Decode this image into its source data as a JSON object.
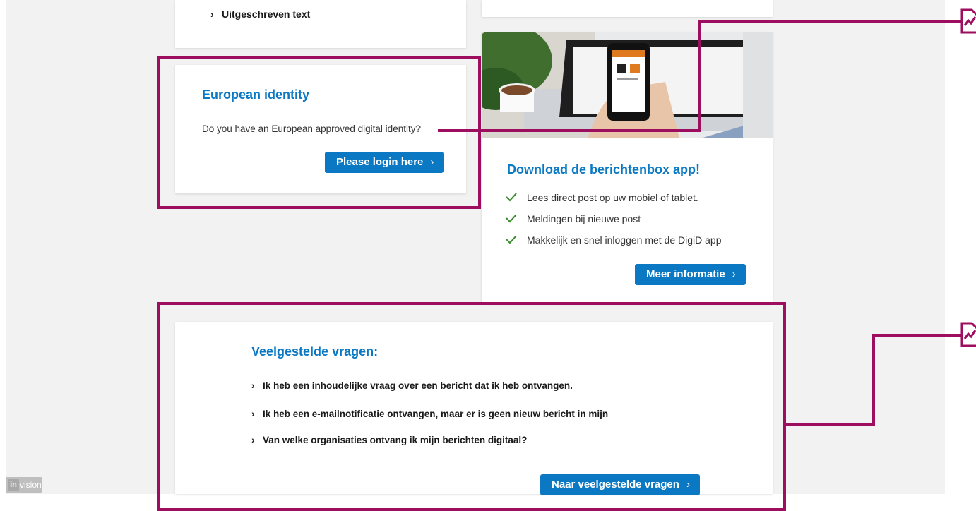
{
  "top_left_card": {
    "link_label": "Uitgeschreven text"
  },
  "european_identity": {
    "title": "European identity",
    "question": "Do you have an European approved digital identity?",
    "button_label": "Please login here"
  },
  "app_promo": {
    "title": "Download de berichtenbox app!",
    "features": [
      "Lees direct post op uw mobiel of tablet.",
      "Meldingen bij nieuwe post",
      "Makkelijk en snel inloggen met de DigiD app"
    ],
    "button_label": "Meer informatie"
  },
  "faq": {
    "title": "Veelgestelde vragen:",
    "items": [
      "Ik heb een inhoudelijke vraag over een bericht dat ik heb ontvangen.",
      "Ik heb een e-mailnotificatie ontvangen, maar er is geen nieuw bericht in mijn",
      "Van welke organisaties ontvang ik mijn berichten digitaal?"
    ],
    "button_label": "Naar veelgestelde vragen"
  },
  "invision_badge": {
    "label": "vision",
    "mark": "in"
  },
  "colors": {
    "accent_blue": "#0a78c3",
    "hotspot_magenta": "#9e0e5f",
    "check_green": "#3a8a2e"
  },
  "icons": {
    "chevron": "chevron-right-icon",
    "check": "check-icon",
    "hotspot": "hotspot-link-icon"
  }
}
